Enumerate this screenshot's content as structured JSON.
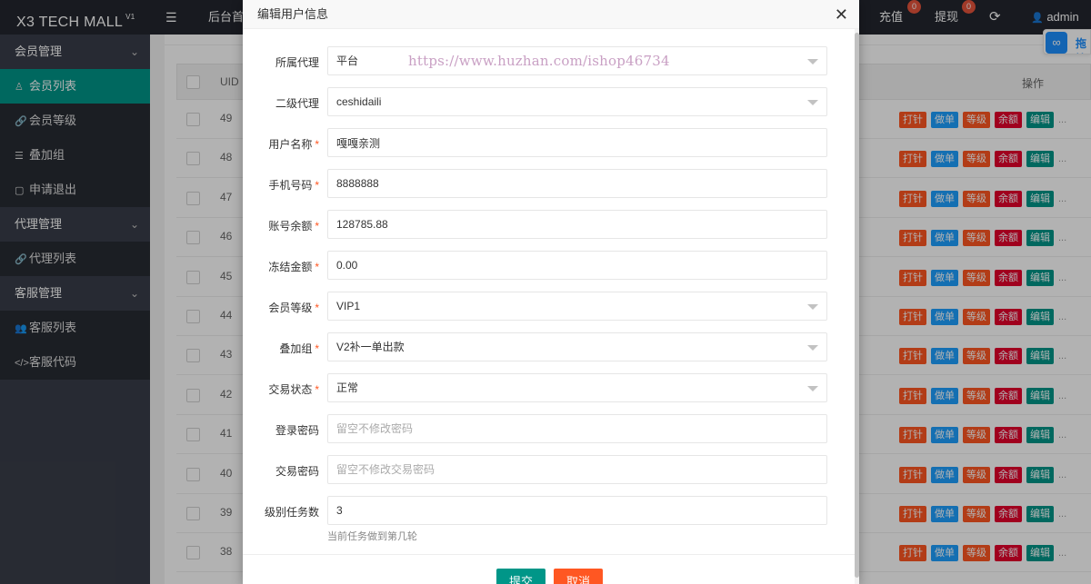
{
  "header": {
    "logo": "X3 TECH MALL",
    "logo_version": "V1",
    "menu_icon": "☰",
    "home_tab": "后台首",
    "recharge": {
      "label": "充值",
      "badge": "0"
    },
    "withdraw": {
      "label": "提现",
      "badge": "0"
    },
    "refresh_icon": "⟳",
    "user_icon": "👤",
    "user": "admin",
    "floating_button": {
      "icon": "∞",
      "label": "拖拽"
    }
  },
  "sidebar": {
    "groups": [
      {
        "label": "会员管理",
        "chevron": "⌄"
      },
      {
        "label": "代理管理",
        "chevron": "⌄"
      },
      {
        "label": "客服管理",
        "chevron": "⌄"
      }
    ],
    "items": [
      {
        "label": "会员列表",
        "icon": "♙",
        "active": true
      },
      {
        "label": "会员等级",
        "icon": "🔗",
        "active": false
      },
      {
        "label": "叠加组",
        "icon": "☰",
        "active": false
      },
      {
        "label": "申请退出",
        "icon": "▢",
        "active": false
      },
      {
        "label": "代理列表",
        "icon": "🔗",
        "active": false
      },
      {
        "label": "客服列表",
        "icon": "👥",
        "active": false
      },
      {
        "label": "客服代码",
        "icon": "</>",
        "active": false
      }
    ]
  },
  "table": {
    "columns": {
      "uid": "UID",
      "ops": "操作"
    },
    "rows": [
      "49",
      "48",
      "47",
      "46",
      "45",
      "44",
      "43",
      "42",
      "41",
      "40",
      "39",
      "38"
    ],
    "actions": [
      "打针",
      "做单",
      "等级",
      "余额",
      "编辑"
    ],
    "more": "..."
  },
  "modal": {
    "title": "编辑用户信息",
    "close_icon": "✕",
    "watermark": "https://www.huzhan.com/ishop46734",
    "fields": [
      {
        "label": "所属代理",
        "required": "",
        "value": "平台",
        "type": "select"
      },
      {
        "label": "二级代理",
        "required": "",
        "value": "ceshidaili",
        "type": "select"
      },
      {
        "label": "用户名称",
        "required": "*",
        "value": "嘎嘎亲测",
        "type": "text"
      },
      {
        "label": "手机号码",
        "required": "*",
        "value": "8888888",
        "type": "text"
      },
      {
        "label": "账号余额",
        "required": "*",
        "value": "128785.88",
        "type": "text"
      },
      {
        "label": "冻结金额",
        "required": "*",
        "value": "0.00",
        "type": "text"
      },
      {
        "label": "会员等级",
        "required": "*",
        "value": "VIP1",
        "type": "select"
      },
      {
        "label": "叠加组",
        "required": "*",
        "value": "V2补一单出款",
        "type": "select"
      },
      {
        "label": "交易状态",
        "required": "*",
        "value": "正常",
        "type": "select"
      },
      {
        "label": "登录密码",
        "required": "",
        "placeholder": "留空不修改密码",
        "type": "password"
      },
      {
        "label": "交易密码",
        "required": "",
        "placeholder": "留空不修改交易密码",
        "type": "password"
      },
      {
        "label": "级别任务数",
        "required": "",
        "value": "3",
        "type": "text"
      }
    ],
    "help_text": "当前任务做到第几轮",
    "submit_label": "提交",
    "cancel_label": "取消"
  }
}
